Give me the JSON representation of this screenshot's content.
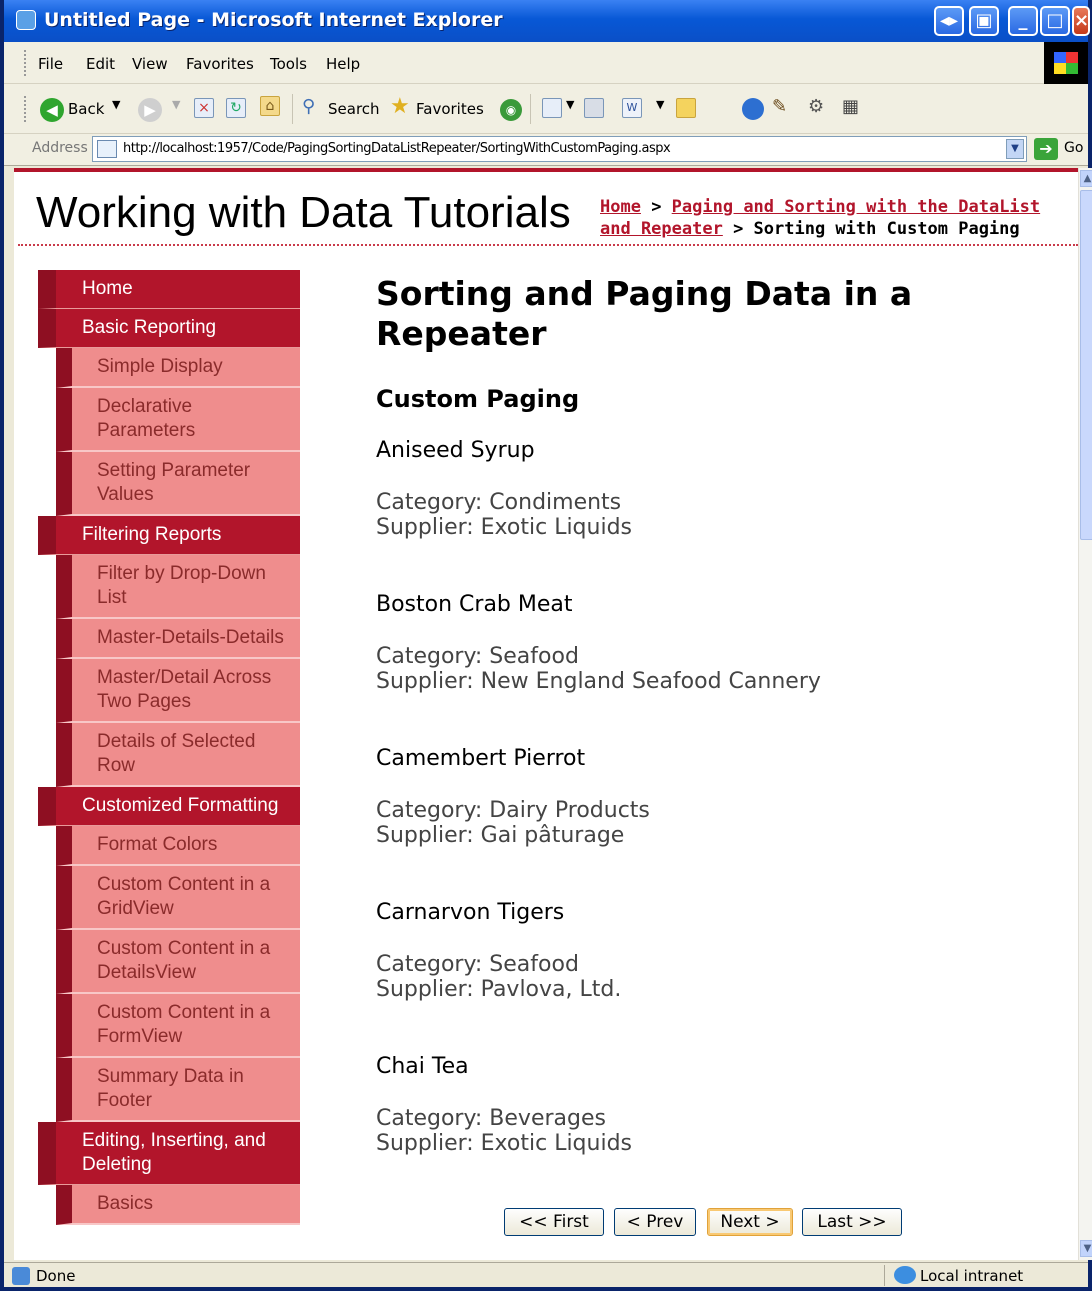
{
  "window": {
    "title": "Untitled Page - Microsoft Internet Explorer"
  },
  "menu": [
    "File",
    "Edit",
    "View",
    "Favorites",
    "Tools",
    "Help"
  ],
  "toolbar": {
    "back": "Back",
    "search": "Search",
    "favorites": "Favorites"
  },
  "address": {
    "label": "Address",
    "url": "http://localhost:1957/Code/PagingSortingDataListRepeater/SortingWithCustomPaging.aspx",
    "go": "Go"
  },
  "site": {
    "title": "Working with Data Tutorials"
  },
  "breadcrumb": {
    "home": "Home",
    "sep1": " > ",
    "parent": "Paging and Sorting with the DataList and Repeater",
    "sep2": " > ",
    "current": "Sorting with Custom Paging"
  },
  "sidebar": [
    {
      "type": "section",
      "label": "Home"
    },
    {
      "type": "section",
      "label": "Basic Reporting"
    },
    {
      "type": "item",
      "label": "Simple Display"
    },
    {
      "type": "item",
      "label": "Declarative Parameters"
    },
    {
      "type": "item",
      "label": "Setting Parameter Values"
    },
    {
      "type": "section",
      "label": "Filtering Reports"
    },
    {
      "type": "item",
      "label": "Filter by Drop-Down List"
    },
    {
      "type": "item",
      "label": "Master-Details-Details"
    },
    {
      "type": "item",
      "label": "Master/Detail Across Two Pages"
    },
    {
      "type": "item",
      "label": "Details of Selected Row"
    },
    {
      "type": "section",
      "label": "Customized Formatting"
    },
    {
      "type": "item",
      "label": "Format Colors"
    },
    {
      "type": "item",
      "label": "Custom Content in a GridView"
    },
    {
      "type": "item",
      "label": "Custom Content in a DetailsView"
    },
    {
      "type": "item",
      "label": "Custom Content in a FormView"
    },
    {
      "type": "item",
      "label": "Summary Data in Footer"
    },
    {
      "type": "section",
      "label": "Editing, Inserting, and Deleting"
    },
    {
      "type": "item",
      "label": "Basics"
    }
  ],
  "main": {
    "heading": "Sorting and Paging Data in a Repeater",
    "subheading": "Custom Paging",
    "products": [
      {
        "name": "Aniseed Syrup",
        "category": "Category: Condiments",
        "supplier": "Supplier: Exotic Liquids"
      },
      {
        "name": "Boston Crab Meat",
        "category": "Category: Seafood",
        "supplier": "Supplier: New England Seafood Cannery"
      },
      {
        "name": "Camembert Pierrot",
        "category": "Category: Dairy Products",
        "supplier": "Supplier: Gai pâturage"
      },
      {
        "name": "Carnarvon Tigers",
        "category": "Category: Seafood",
        "supplier": "Supplier: Pavlova, Ltd."
      },
      {
        "name": "Chai Tea",
        "category": "Category: Beverages",
        "supplier": "Supplier: Exotic Liquids"
      }
    ],
    "pager": {
      "first": "<< First",
      "prev": "< Prev",
      "next": "Next >",
      "last": "Last >>"
    }
  },
  "status": {
    "text": "Done",
    "zone": "Local intranet"
  }
}
